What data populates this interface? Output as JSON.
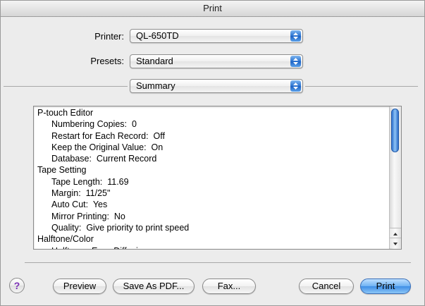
{
  "window": {
    "title": "Print"
  },
  "form": {
    "printer_label": "Printer:",
    "printer_value": "QL-650TD",
    "presets_label": "Presets:",
    "presets_value": "Standard",
    "panel_value": "Summary"
  },
  "summary": {
    "lines": [
      {
        "text": "P-touch Editor",
        "indent": 0
      },
      {
        "text": "Numbering Copies:  0",
        "indent": 1
      },
      {
        "text": "Restart for Each Record:  Off",
        "indent": 1
      },
      {
        "text": "Keep the Original Value:  On",
        "indent": 1
      },
      {
        "text": "Database:  Current Record",
        "indent": 1
      },
      {
        "text": "Tape Setting",
        "indent": 0
      },
      {
        "text": "Tape Length:  11.69",
        "indent": 1
      },
      {
        "text": "Margin:  11/25\"",
        "indent": 1
      },
      {
        "text": "Auto Cut:  Yes",
        "indent": 1
      },
      {
        "text": "Mirror Printing:  No",
        "indent": 1
      },
      {
        "text": "Quality:  Give priority to print speed",
        "indent": 1
      },
      {
        "text": "Halftone/Color",
        "indent": 0
      },
      {
        "text": "Halftone:  Error Diffusion",
        "indent": 1
      }
    ]
  },
  "buttons": {
    "help": "?",
    "preview": "Preview",
    "save_pdf": "Save As PDF...",
    "fax": "Fax...",
    "cancel": "Cancel",
    "print": "Print"
  },
  "colors": {
    "default_button": "#5aa0ea",
    "scroll_thumb": "#5aa0ea"
  }
}
